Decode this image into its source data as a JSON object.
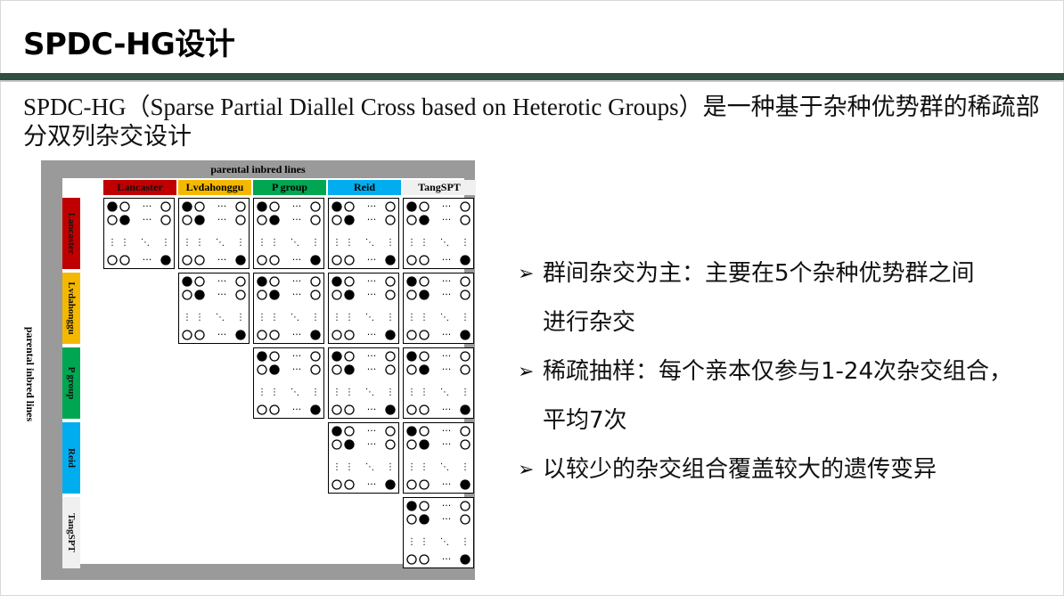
{
  "slide": {
    "title": "SPDC-HG设计",
    "intro": "SPDC-HG（Sparse Partial Diallel Cross based on Heterotic Groups）是一种基于杂种优势群的稀疏部分双列杂交设计"
  },
  "figure": {
    "top_title": "parental inbred lines",
    "side_title": "parental inbred lines",
    "groups": [
      {
        "name": "Lancaster",
        "color": "#c00000"
      },
      {
        "name": "Lvdahonggu",
        "color": "#f5b800"
      },
      {
        "name": "P group",
        "color": "#00a651"
      },
      {
        "name": "Reid",
        "color": "#00aeef"
      },
      {
        "name": "TangSPT",
        "color": "#f0f0f0"
      }
    ],
    "ellipsis": "···",
    "vdots": "⋮",
    "ddots": "⋱"
  },
  "bullets": [
    {
      "lines": [
        "群间杂交为主：主要在5个杂种优势群之间",
        "进行杂交"
      ]
    },
    {
      "lines": [
        "稀疏抽样：每个亲本仅参与1-24次杂交组合，",
        "平均7次"
      ]
    },
    {
      "lines": [
        "以较少的杂交组合覆盖较大的遗传变异"
      ]
    }
  ],
  "icons": {
    "bullet": "arrow-right-icon"
  }
}
